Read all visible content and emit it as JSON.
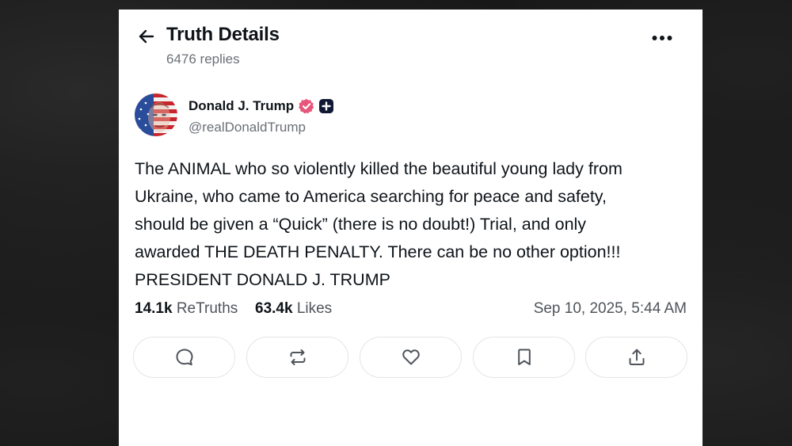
{
  "header": {
    "title": "Truth Details",
    "replies": "6476 replies",
    "back_icon": "arrow-left-icon",
    "more_icon": "ellipsis-icon"
  },
  "author": {
    "name": "Donald J. Trump",
    "handle": "@realDonaldTrump",
    "verified_color": "#e8557a",
    "badge_color": "#0f1933"
  },
  "post": {
    "lines": [
      "The ANIMAL who so violently killed the beautiful young lady from",
      "Ukraine, who came to America searching for peace and safety,",
      "should be given a “Quick” (there is no doubt!) Trial, and only",
      "awarded THE DEATH PENALTY. There can be no other option!!!",
      "PRESIDENT DONALD J. TRUMP"
    ]
  },
  "stats": {
    "retruths_count": "14.1k",
    "retruths_label": "ReTruths",
    "likes_count": "63.4k",
    "likes_label": "Likes",
    "date": "Sep 10, 2025, 5:44 AM"
  },
  "actions": [
    {
      "name": "reply",
      "icon": "chat-bubble-icon"
    },
    {
      "name": "retruth",
      "icon": "repost-icon"
    },
    {
      "name": "like",
      "icon": "heart-icon"
    },
    {
      "name": "bookmark",
      "icon": "bookmark-icon"
    },
    {
      "name": "share",
      "icon": "share-icon"
    }
  ]
}
